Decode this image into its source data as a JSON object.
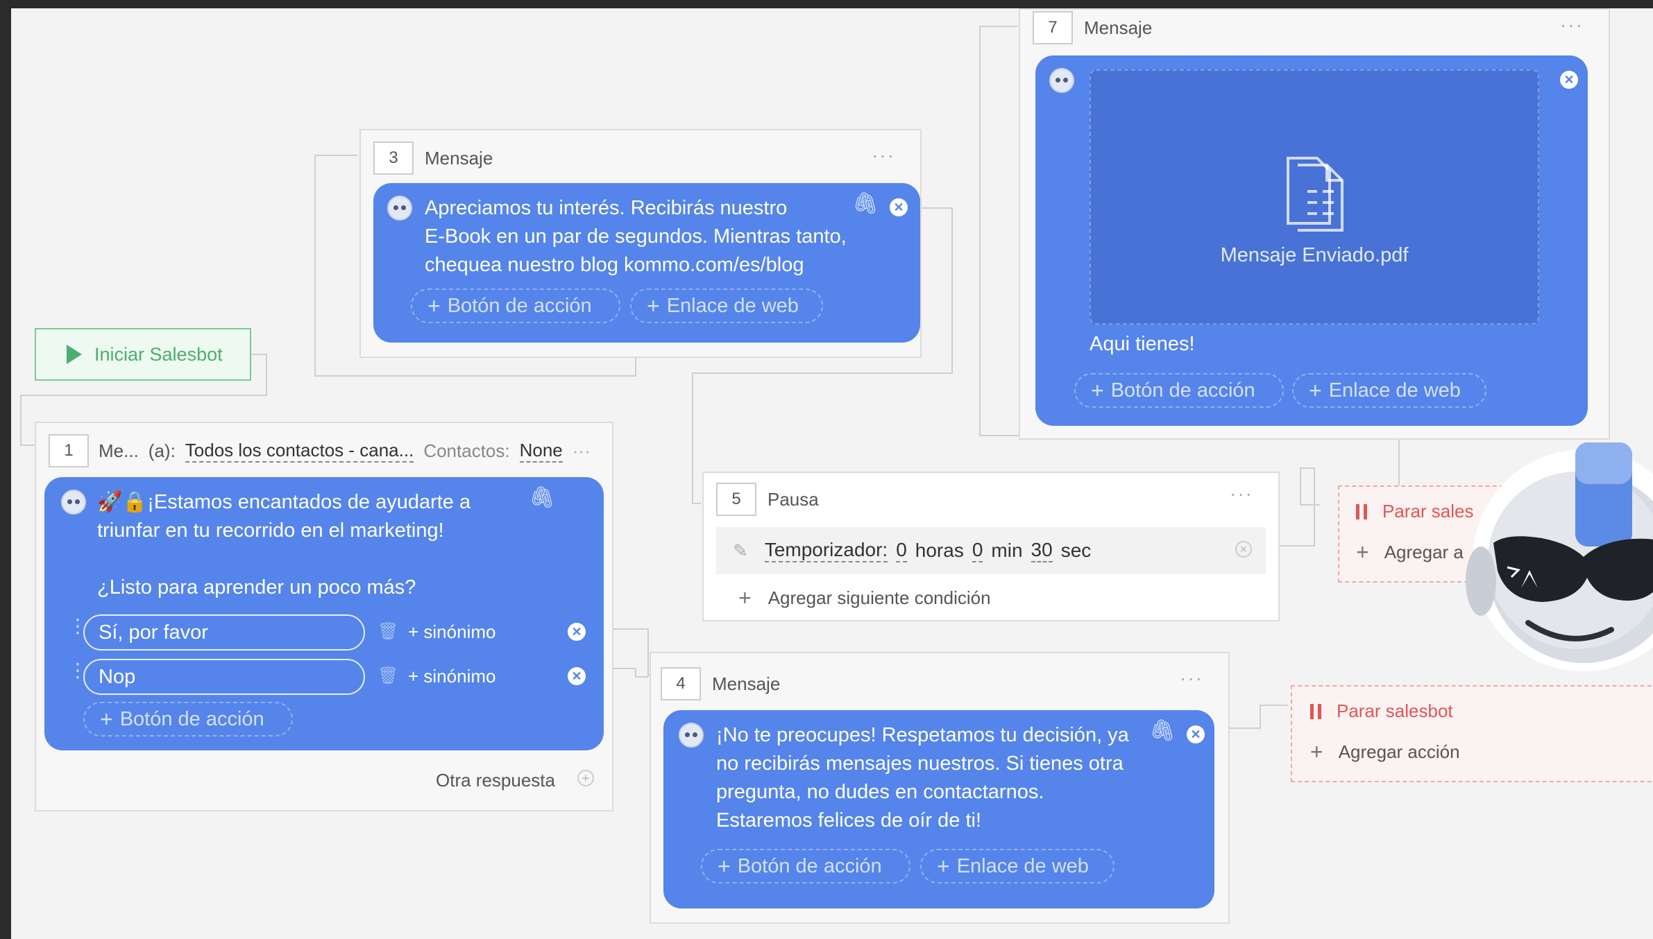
{
  "start": {
    "label": "Iniciar Salesbot"
  },
  "node3": {
    "number": "3",
    "title": "Mensaje",
    "more": "···",
    "text": "Apreciamos tu interés. Recibirás nuestro\nE-Book en un par de segundos. Mientras tanto,\nchequea nuestro blog kommo.com/es/blog",
    "action_button": "Botón de acción",
    "web_link": "Enlace de web"
  },
  "node1": {
    "number": "1",
    "title": "Me...",
    "to_label": "(a):",
    "to_value": "Todos los contactos - cana...",
    "contacts_label": "Contactos:",
    "contacts_value": "None",
    "more": "···",
    "text": "🚀🔒¡Estamos encantados de ayudarte a\ntriunfar en tu recorrido en el marketing!\n\n¿Listo para aprender un poco más?",
    "answers": [
      {
        "label": "Sí, por favor",
        "synonym": "+ sinónimo"
      },
      {
        "label": "Nop",
        "synonym": "+ sinónimo"
      }
    ],
    "action_button": "Botón de acción",
    "other_response": "Otra respuesta"
  },
  "node7": {
    "number": "7",
    "title": "Mensaje",
    "more": "···",
    "file_name": "Mensaje Enviado.pdf",
    "caption": "Aqui tienes!",
    "action_button": "Botón de acción",
    "web_link": "Enlace de web"
  },
  "node5": {
    "number": "5",
    "title": "Pausa",
    "more": "···",
    "timer_label": "Temporizador:",
    "hours_value": "0",
    "hours_unit": "horas",
    "min_value": "0",
    "min_unit": "min",
    "sec_value": "30",
    "sec_unit": "sec",
    "add_condition": "Agregar siguiente condición"
  },
  "node4": {
    "number": "4",
    "title": "Mensaje",
    "more": "···",
    "text": "¡No te preocupes! Respetamos tu decisión, ya\nno recibirás mensajes nuestros. Si tienes otra\npregunta, no dudes en contactarnos.\nEstaremos felices de oír de ti!",
    "action_button": "Botón de acción",
    "web_link": "Enlace de web"
  },
  "stop_top": {
    "label": "Parar sales",
    "add": "Agregar a"
  },
  "stop_bottom": {
    "label": "Parar salesbot",
    "add": "Agregar acción"
  },
  "colors": {
    "bubble": "#5585ea",
    "start": "#4cae6d",
    "stop": "#e05656"
  }
}
